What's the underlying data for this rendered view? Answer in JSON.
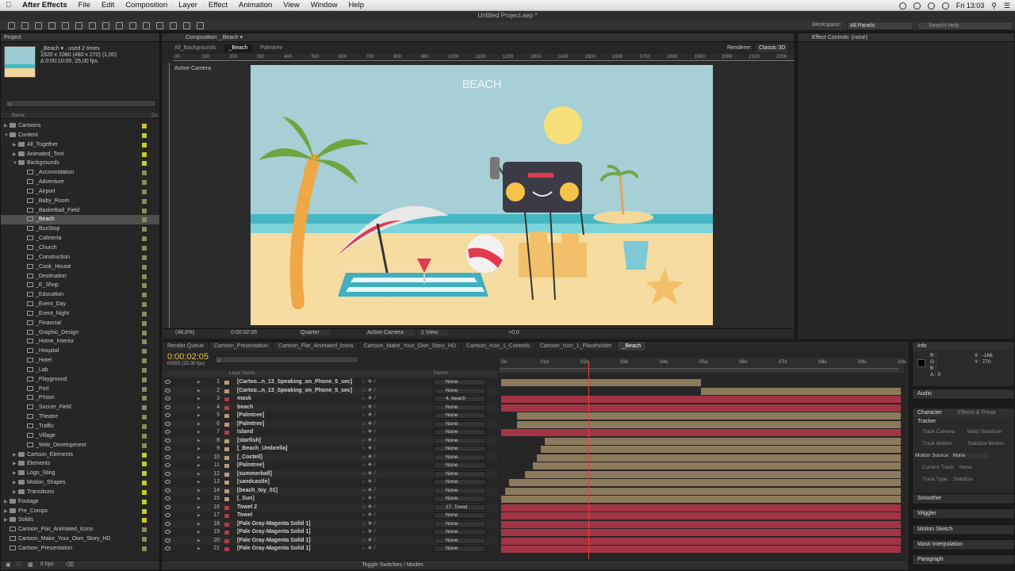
{
  "menubar": {
    "app": "After Effects",
    "items": [
      "File",
      "Edit",
      "Composition",
      "Layer",
      "Effect",
      "Animation",
      "View",
      "Window",
      "Help"
    ],
    "clock": "Fri 13:03"
  },
  "window_title": "Untitled Project.aep *",
  "workspace": {
    "label": "Workspace:",
    "value": "All Panels",
    "search_placeholder": "Search Help"
  },
  "project": {
    "tab": "Project",
    "thumb_name": "_Beach ▾ , used 2 times",
    "thumb_size": "1920 x 1080  (480 x 270) (1,00)",
    "thumb_dur": "Δ 0:00:10:00, 25,00 fps",
    "col_name": "Name",
    "col_comment": "Co",
    "items": [
      {
        "label": "Cartoons",
        "indent": 0,
        "type": "folder",
        "tw": "▶",
        "lb": true
      },
      {
        "label": "Content",
        "indent": 0,
        "type": "folder",
        "tw": "▼",
        "lb": true
      },
      {
        "label": "All_Together",
        "indent": 1,
        "type": "folder",
        "tw": "▶",
        "lb": true
      },
      {
        "label": "Animated_Text",
        "indent": 1,
        "type": "folder",
        "tw": "▶",
        "lb": true
      },
      {
        "label": "Backgrounds",
        "indent": 1,
        "type": "folder",
        "tw": "▼",
        "lb": true
      },
      {
        "label": "_Accomodation",
        "indent": 2,
        "type": "comp",
        "tw": "",
        "lb": false
      },
      {
        "label": "_Adventure",
        "indent": 2,
        "type": "comp",
        "tw": "",
        "lb": false
      },
      {
        "label": "_Airport",
        "indent": 2,
        "type": "comp",
        "tw": "",
        "lb": false
      },
      {
        "label": "_Baby_Room",
        "indent": 2,
        "type": "comp",
        "tw": "",
        "lb": false
      },
      {
        "label": "_Basketball_Field",
        "indent": 2,
        "type": "comp",
        "tw": "",
        "lb": false
      },
      {
        "label": "_Beach",
        "indent": 2,
        "type": "comp",
        "tw": "",
        "lb": false,
        "sel": true
      },
      {
        "label": "_BusStop",
        "indent": 2,
        "type": "comp",
        "tw": "",
        "lb": false
      },
      {
        "label": "_Cafeteria",
        "indent": 2,
        "type": "comp",
        "tw": "",
        "lb": false
      },
      {
        "label": "_Church",
        "indent": 2,
        "type": "comp",
        "tw": "",
        "lb": false
      },
      {
        "label": "_Construction",
        "indent": 2,
        "type": "comp",
        "tw": "",
        "lb": false
      },
      {
        "label": "_Cook_House",
        "indent": 2,
        "type": "comp",
        "tw": "",
        "lb": false
      },
      {
        "label": "_Destination",
        "indent": 2,
        "type": "comp",
        "tw": "",
        "lb": false
      },
      {
        "label": "_E_Shop",
        "indent": 2,
        "type": "comp",
        "tw": "",
        "lb": false
      },
      {
        "label": "_Education",
        "indent": 2,
        "type": "comp",
        "tw": "",
        "lb": false
      },
      {
        "label": "_Event_Day",
        "indent": 2,
        "type": "comp",
        "tw": "",
        "lb": false
      },
      {
        "label": "_Event_Night",
        "indent": 2,
        "type": "comp",
        "tw": "",
        "lb": false
      },
      {
        "label": "_Financial",
        "indent": 2,
        "type": "comp",
        "tw": "",
        "lb": false
      },
      {
        "label": "_Graphic_Design",
        "indent": 2,
        "type": "comp",
        "tw": "",
        "lb": false
      },
      {
        "label": "_Home_Interior",
        "indent": 2,
        "type": "comp",
        "tw": "",
        "lb": false
      },
      {
        "label": "_Hospital",
        "indent": 2,
        "type": "comp",
        "tw": "",
        "lb": false
      },
      {
        "label": "_Hotel",
        "indent": 2,
        "type": "comp",
        "tw": "",
        "lb": false
      },
      {
        "label": "_Lab",
        "indent": 2,
        "type": "comp",
        "tw": "",
        "lb": false
      },
      {
        "label": "_Playground",
        "indent": 2,
        "type": "comp",
        "tw": "",
        "lb": false
      },
      {
        "label": "_Port",
        "indent": 2,
        "type": "comp",
        "tw": "",
        "lb": false
      },
      {
        "label": "_Prison",
        "indent": 2,
        "type": "comp",
        "tw": "",
        "lb": false
      },
      {
        "label": "_Soccer_Field",
        "indent": 2,
        "type": "comp",
        "tw": "",
        "lb": false
      },
      {
        "label": "_Theatre",
        "indent": 2,
        "type": "comp",
        "tw": "",
        "lb": false
      },
      {
        "label": "_Traffic",
        "indent": 2,
        "type": "comp",
        "tw": "",
        "lb": false
      },
      {
        "label": "_Village",
        "indent": 2,
        "type": "comp",
        "tw": "",
        "lb": false
      },
      {
        "label": "_Web_Development",
        "indent": 2,
        "type": "comp",
        "tw": "",
        "lb": false
      },
      {
        "label": "Cartoon_Elements",
        "indent": 1,
        "type": "folder",
        "tw": "▶",
        "lb": true
      },
      {
        "label": "Elements",
        "indent": 1,
        "type": "folder",
        "tw": "▶",
        "lb": true
      },
      {
        "label": "Logo_Sting",
        "indent": 1,
        "type": "folder",
        "tw": "▶",
        "lb": true
      },
      {
        "label": "Motion_Shapes",
        "indent": 1,
        "type": "folder",
        "tw": "▶",
        "lb": true
      },
      {
        "label": "Transitions",
        "indent": 1,
        "type": "folder",
        "tw": "▶",
        "lb": true
      },
      {
        "label": "Footage",
        "indent": 0,
        "type": "folder",
        "tw": "▶",
        "lb": true
      },
      {
        "label": "Pre_Comps",
        "indent": 0,
        "type": "folder",
        "tw": "▶",
        "lb": true
      },
      {
        "label": "Solids",
        "indent": 0,
        "type": "folder",
        "tw": "▶",
        "lb": true
      },
      {
        "label": "Cartoon_Flat_Animated_Icons",
        "indent": 0,
        "type": "comp",
        "tw": "",
        "lb": false
      },
      {
        "label": "Cartoon_Make_Your_Own_Story_HD",
        "indent": 0,
        "type": "comp",
        "tw": "",
        "lb": false
      },
      {
        "label": "Cartoon_Presentation",
        "indent": 0,
        "type": "comp",
        "tw": "",
        "lb": false
      }
    ],
    "bpc": "8 bpc"
  },
  "composition": {
    "tab": "Composition: _Beach ▾",
    "breadcrumbs": [
      "All_Backgrounds",
      "_Beach",
      "Palmtree"
    ],
    "renderer_label": "Renderer:",
    "renderer": "Classic 3D",
    "active_camera": "Active Camera",
    "scene_title": "BEACH",
    "viewer_bar": {
      "zoom": "(48,6%)",
      "time": "0:00:02:05",
      "res": "Quarter",
      "camera": "Active Camera",
      "views": "1 View",
      "exposure": "+0,0"
    },
    "ruler": [
      "00",
      "100",
      "200",
      "300",
      "400",
      "500",
      "600",
      "700",
      "800",
      "900",
      "1000",
      "1100",
      "1200",
      "1300",
      "1400",
      "1500",
      "1600",
      "1700",
      "1800",
      "1900",
      "2000",
      "2100",
      "2200"
    ]
  },
  "effect_controls": {
    "tab": "Effect Controls: (none)"
  },
  "timeline": {
    "tabs": [
      {
        "label": "Render Queue",
        "on": false
      },
      {
        "label": "Cartoon_Presentation",
        "on": false
      },
      {
        "label": "Cartoon_Flat_Animated_Icons",
        "on": false
      },
      {
        "label": "Cartoon_Make_Your_Own_Story_HD",
        "on": false
      },
      {
        "label": "Cartoon_Icon_1_Controls",
        "on": false
      },
      {
        "label": "Cartoon_Icon_1_Placeholder",
        "on": false
      },
      {
        "label": "_Beach",
        "on": true
      }
    ],
    "timecode": "0:00:02:05",
    "frames": "00055 (25.00 fps)",
    "col_layer": "Layer Name",
    "col_parent": "Parent",
    "time_marks": [
      "0s",
      "01s",
      "02s",
      "03s",
      "04s",
      "05s",
      "06s",
      "07s",
      "08s",
      "09s",
      "10s"
    ],
    "current_time_fraction": 0.218,
    "layers": [
      {
        "num": "1",
        "name": "[Cartoo...n_13_Speaking_on_Phone_5_sec]",
        "color": "#b89d75",
        "parent": "None",
        "bar": "tan",
        "start": 0,
        "end": 0.5
      },
      {
        "num": "2",
        "name": "[Cartoo...n_13_Speaking_on_Phone_5_sec]",
        "color": "#b89d75",
        "parent": "None",
        "bar": "tan",
        "start": 0.5,
        "end": 1
      },
      {
        "num": "3",
        "name": "mask",
        "color": "#b03c4a",
        "parent": "4. beach",
        "bar": "red",
        "start": 0,
        "end": 1
      },
      {
        "num": "4",
        "name": "beach",
        "color": "#b03c4a",
        "parent": "None",
        "bar": "red",
        "start": 0,
        "end": 1
      },
      {
        "num": "5",
        "name": "[Palmtree]",
        "color": "#b89d75",
        "parent": "None",
        "bar": "tan",
        "start": 0.04,
        "end": 1
      },
      {
        "num": "6",
        "name": "[Palmtree]",
        "color": "#b89d75",
        "parent": "None",
        "bar": "tan",
        "start": 0.04,
        "end": 1
      },
      {
        "num": "7",
        "name": "Island",
        "color": "#b03c4a",
        "parent": "None",
        "bar": "red",
        "start": 0,
        "end": 1
      },
      {
        "num": "8",
        "name": "[starfish]",
        "color": "#b89d75",
        "parent": "None",
        "bar": "tan",
        "start": 0.11,
        "end": 1
      },
      {
        "num": "9",
        "name": "[_Beach_Umbrella]",
        "color": "#b89d75",
        "parent": "None",
        "bar": "tan",
        "start": 0.1,
        "end": 1
      },
      {
        "num": "10",
        "name": "[_Cocteil]",
        "color": "#b89d75",
        "parent": "None",
        "bar": "tan",
        "start": 0.09,
        "end": 1
      },
      {
        "num": "11",
        "name": "[Palmtree]",
        "color": "#b89d75",
        "parent": "None",
        "bar": "tan",
        "start": 0.08,
        "end": 1
      },
      {
        "num": "12",
        "name": "[summerball]",
        "color": "#b89d75",
        "parent": "None",
        "bar": "tan",
        "start": 0.06,
        "end": 1
      },
      {
        "num": "13",
        "name": "[sandcastle]",
        "color": "#b89d75",
        "parent": "None",
        "bar": "tan",
        "start": 0.02,
        "end": 1
      },
      {
        "num": "14",
        "name": "[beach_toy_01]",
        "color": "#b89d75",
        "parent": "None",
        "bar": "tan",
        "start": 0.01,
        "end": 1
      },
      {
        "num": "15",
        "name": "[_Sun]",
        "color": "#b89d75",
        "parent": "None",
        "bar": "tan",
        "start": 0,
        "end": 1
      },
      {
        "num": "16",
        "name": "Towel 2",
        "color": "#b03c4a",
        "parent": "17. Towel",
        "bar": "red",
        "start": 0,
        "end": 1
      },
      {
        "num": "17",
        "name": "Towel",
        "color": "#b03c4a",
        "parent": "None",
        "bar": "red",
        "start": 0,
        "end": 1
      },
      {
        "num": "18",
        "name": "[Pale Gray-Magenta Solid 1]",
        "color": "#b03c4a",
        "parent": "None",
        "bar": "red",
        "start": 0,
        "end": 1
      },
      {
        "num": "19",
        "name": "[Pale Gray-Magenta Solid 1]",
        "color": "#b03c4a",
        "parent": "None",
        "bar": "red",
        "start": 0,
        "end": 1
      },
      {
        "num": "20",
        "name": "[Pale Gray-Magenta Solid 1]",
        "color": "#b03c4a",
        "parent": "None",
        "bar": "red",
        "start": 0,
        "end": 1
      },
      {
        "num": "21",
        "name": "[Pale Gray-Magenta Solid 1]",
        "color": "#b03c4a",
        "parent": "None",
        "bar": "red",
        "start": 0,
        "end": 1
      }
    ],
    "toggle_label": "Toggle Switches / Modes"
  },
  "info": {
    "tab": "Info",
    "r": "R :",
    "g": "G :",
    "b": "B :",
    "a": "A : 0",
    "x": "X : -166",
    "y": "Y : 770"
  },
  "right_panels": {
    "audio": "Audio",
    "character": "Character",
    "effects": "Effects & Prese",
    "tracker": "Tracker",
    "track_camera": "Track Camera",
    "warp_stabilizer": "Warp Stabilizer",
    "track_motion": "Track Motion",
    "stabilize_motion": "Stabilize Motion",
    "motion_source_label": "Motion Source:",
    "motion_source": "None",
    "current_track_label": "Current Track:",
    "current_track": "None",
    "track_type_label": "Track Type:",
    "track_type": "Stabilize",
    "smoother": "Smoother",
    "wiggler": "Wiggler",
    "motion_sketch": "Motion Sketch",
    "mask_interpolation": "Mask Interpolation",
    "paragraph": "Paragraph"
  }
}
